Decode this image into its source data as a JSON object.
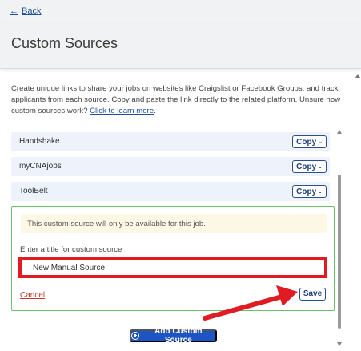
{
  "nav": {
    "back_label": "Back",
    "back_arrow": "←"
  },
  "header": {
    "title": "Custom Sources"
  },
  "description": {
    "text": "Create unique links to share your jobs on websites like Craigslist or Facebook Groups, and track applicants from each source. Copy and paste the link directly to the related platform. Unsure how custom sources work?",
    "link": "Click to learn more",
    "suffix": "."
  },
  "sources": [
    {
      "name": "Handshake",
      "copy_label": "Copy"
    },
    {
      "name": "myCNAjobs",
      "copy_label": "Copy"
    },
    {
      "name": "ToolBelt",
      "copy_label": "Copy"
    }
  ],
  "custom_form": {
    "notice": "This custom source will only be available for this job.",
    "field_label": "Enter a title for custom source",
    "field_value": "New Manual Source",
    "cancel_label": "Cancel",
    "save_label": "Save"
  },
  "footer": {
    "add_label": "Add Custom Source"
  },
  "colors": {
    "accent": "#1e55c4",
    "highlight": "#e01b22",
    "panel_border": "#6cbf6c",
    "notice_bg": "#fdf8e6",
    "row_bg": "#edf2fb"
  },
  "icons": {
    "back": "arrow-left-icon",
    "copy": "chevron-down-icon",
    "add": "plus-circle-icon"
  }
}
